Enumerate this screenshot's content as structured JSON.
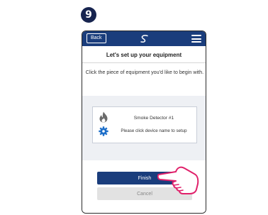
{
  "step": {
    "number": "9"
  },
  "topbar": {
    "back_label": "Back",
    "logo_icon": "swirl-logo-icon",
    "menu_icon": "hamburger-menu-icon",
    "color": "#1a3d7c"
  },
  "header": {
    "title": "Let's set up your equipment",
    "instruction": "Click the piece of equipment you'd like to begin with."
  },
  "device": {
    "name": "Smoke Detector #1",
    "hint": "Please click device name to setup",
    "icons": [
      "flame-icon",
      "gear-icon"
    ]
  },
  "actions": {
    "finish_label": "Finish",
    "cancel_label": "Cancel"
  },
  "overlay": {
    "icon": "pointing-hand-icon"
  },
  "colors": {
    "primary": "#1a3d7c",
    "badge": "#17244f",
    "hand": "#e0206a"
  }
}
